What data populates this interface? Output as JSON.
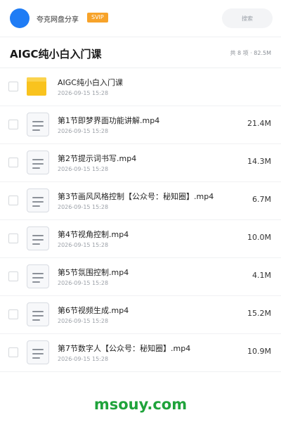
{
  "app": {
    "share_title": "夸克网盘分享",
    "badge": "SVIP",
    "search_placeholder": "搜索",
    "avatar_color": "#1f7cf5"
  },
  "folder": {
    "title": "AIGC纯小白入门课",
    "meta": "共 8 项 · 82.5M"
  },
  "files": [
    {
      "type": "folder",
      "name": "AIGC纯小白入门课",
      "date": "2026-09-15 15:28",
      "size": ""
    },
    {
      "type": "video",
      "name": "第1节即梦界面功能讲解.mp4",
      "date": "2026-09-15 15:28",
      "size": "21.4M"
    },
    {
      "type": "video",
      "name": "第2节提示词书写.mp4",
      "date": "2026-09-15 15:28",
      "size": "14.3M"
    },
    {
      "type": "video",
      "name": "第3节画风风格控制【公众号：秘知圈】.mp4",
      "date": "2026-09-15 15:28",
      "size": "6.7M"
    },
    {
      "type": "video",
      "name": "第4节视角控制.mp4",
      "date": "2026-09-15 15:28",
      "size": "10.0M"
    },
    {
      "type": "video",
      "name": "第5节氛围控制.mp4",
      "date": "2026-09-15 15:28",
      "size": "4.1M"
    },
    {
      "type": "video",
      "name": "第6节视频生成.mp4",
      "date": "2026-09-15 15:28",
      "size": "15.2M"
    },
    {
      "type": "video",
      "name": "第7节数字人【公众号：秘知圈】.mp4",
      "date": "2026-09-15 15:28",
      "size": "10.9M"
    }
  ],
  "watermark": "msouy.com",
  "colors": {
    "svip": "#f7a32a",
    "folder": "#f9c31e",
    "watermark": "#1fa33b"
  }
}
